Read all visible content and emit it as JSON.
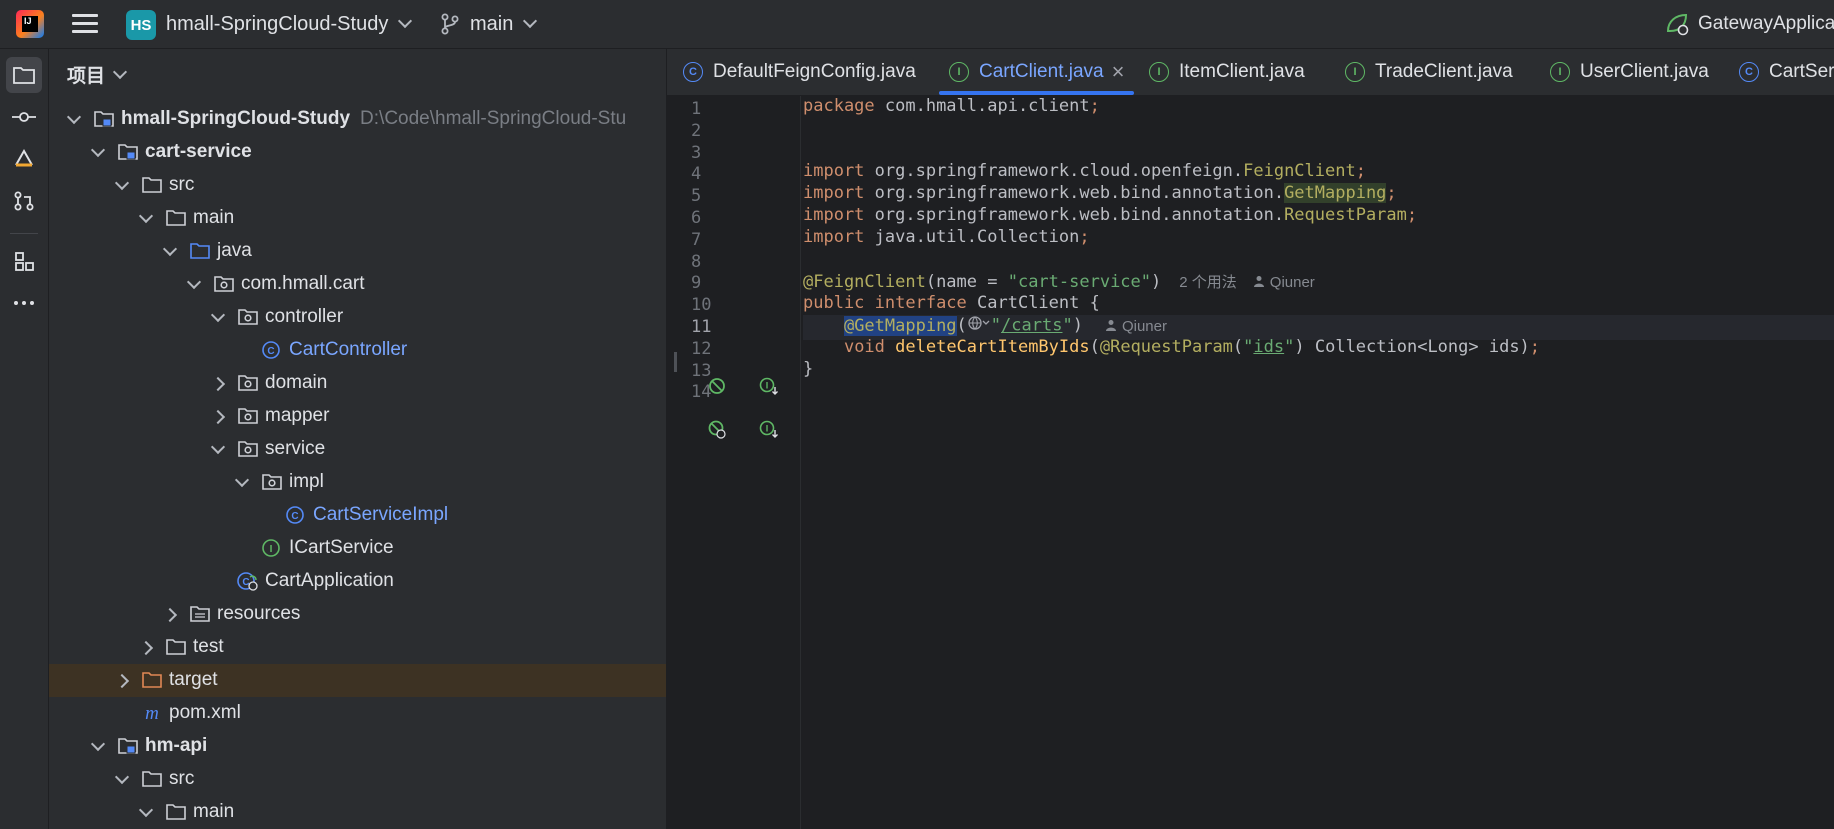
{
  "titlebar": {
    "project_badge": "HS",
    "project_name": "hmall-SpringCloud-Study",
    "branch": "main",
    "run_config": "GatewayApplica"
  },
  "project_panel": {
    "title": "项目",
    "tree": [
      {
        "label": "hmall-SpringCloud-Study",
        "hint": "D:\\Code\\hmall-SpringCloud-Stu",
        "depth": 0,
        "arrow": "down",
        "icon": "module-folder-icon",
        "bold": true
      },
      {
        "label": "cart-service",
        "depth": 1,
        "arrow": "down",
        "icon": "module-folder-icon",
        "bold": true
      },
      {
        "label": "src",
        "depth": 2,
        "arrow": "down",
        "icon": "folder-icon"
      },
      {
        "label": "main",
        "depth": 3,
        "arrow": "down",
        "icon": "folder-icon"
      },
      {
        "label": "java",
        "depth": 4,
        "arrow": "down",
        "icon": "source-folder-icon"
      },
      {
        "label": "com.hmall.cart",
        "depth": 5,
        "arrow": "down",
        "icon": "package-icon"
      },
      {
        "label": "controller",
        "depth": 6,
        "arrow": "down",
        "icon": "package-icon"
      },
      {
        "label": "CartController",
        "depth": 7,
        "arrow": "none",
        "icon": "class-icon",
        "color": "#7aa6ff"
      },
      {
        "label": "domain",
        "depth": 6,
        "arrow": "right",
        "icon": "package-icon"
      },
      {
        "label": "mapper",
        "depth": 6,
        "arrow": "right",
        "icon": "package-icon"
      },
      {
        "label": "service",
        "depth": 6,
        "arrow": "down",
        "icon": "package-icon"
      },
      {
        "label": "impl",
        "depth": 7,
        "arrow": "down",
        "icon": "package-icon"
      },
      {
        "label": "CartServiceImpl",
        "depth": 8,
        "arrow": "none",
        "icon": "class-icon",
        "color": "#7aa6ff"
      },
      {
        "label": "ICartService",
        "depth": 7,
        "arrow": "none",
        "icon": "interface-icon"
      },
      {
        "label": "CartApplication",
        "depth": 6,
        "arrow": "none",
        "icon": "spring-class-icon"
      },
      {
        "label": "resources",
        "depth": 4,
        "arrow": "right",
        "icon": "resources-folder-icon"
      },
      {
        "label": "test",
        "depth": 3,
        "arrow": "right",
        "icon": "folder-icon"
      },
      {
        "label": "target",
        "depth": 2,
        "arrow": "right",
        "icon": "excluded-folder-icon",
        "selected": true
      },
      {
        "label": "pom.xml",
        "depth": 2,
        "arrow": "none",
        "icon": "maven-icon"
      },
      {
        "label": "hm-api",
        "depth": 1,
        "arrow": "down",
        "icon": "module-folder-icon",
        "bold": true
      },
      {
        "label": "src",
        "depth": 2,
        "arrow": "down",
        "icon": "folder-icon"
      },
      {
        "label": "main",
        "depth": 3,
        "arrow": "down",
        "icon": "folder-icon"
      }
    ]
  },
  "tabs": [
    {
      "label": "DefaultFeignConfig.java",
      "icon": "class-icon",
      "glyph": "C",
      "active": false
    },
    {
      "label": "CartClient.java",
      "icon": "interface-icon",
      "glyph": "I",
      "active": true,
      "close": "×"
    },
    {
      "label": "ItemClient.java",
      "icon": "interface-icon",
      "glyph": "I",
      "active": false
    },
    {
      "label": "TradeClient.java",
      "icon": "interface-icon",
      "glyph": "I",
      "active": false
    },
    {
      "label": "UserClient.java",
      "icon": "interface-icon",
      "glyph": "I",
      "active": false
    },
    {
      "label": "CartSer",
      "icon": "class-icon",
      "glyph": "C",
      "active": false
    }
  ],
  "editor": {
    "line_numbers": [
      "1",
      "2",
      "3",
      "4",
      "5",
      "6",
      "7",
      "8",
      "9",
      "10",
      "11",
      "12",
      "13",
      "14"
    ],
    "current_line": "11",
    "code": {
      "l1_kw": "package",
      "l1_rest": " com.hmall.api.client",
      "l1_semi": ";",
      "imp": "import",
      "l4_pkg": " org.springframework.cloud.openfeign.",
      "l4_cls": "FeignClient",
      "l5_pkg": " org.springframework.web.bind.annotation.",
      "l5_cls": "GetMapping",
      "l6_pkg": " org.springframework.web.bind.annotation.",
      "l6_cls": "RequestParam",
      "l7_pkg": " java.util.Collection",
      "semi": ";",
      "l9_ann": "@FeignClient",
      "l9_open": "(name = ",
      "l9_str": "\"cart-service\"",
      "l9_close": ")",
      "l9_usages": "2 个用法",
      "author": "Qiuner",
      "l10_pub": "public",
      "l10_iface": " interface",
      "l10_name": " CartClient {",
      "l11_indent": "    ",
      "l11_ann": "@GetMapping",
      "l11_open": "(",
      "l11_str_q1": "\"",
      "l11_str_path": "/carts",
      "l11_str_q2": "\"",
      "l11_close": ")",
      "l12_indent": "    ",
      "l12_void": "void",
      "l12_method": " deleteCartItemByIds",
      "l12_paren": "(",
      "l12_ann": "@RequestParam",
      "l12_p1": "(",
      "l12_str_q1": "\"",
      "l12_str_val": "ids",
      "l12_str_q2": "\"",
      "l12_rest": ") Collection<Long> ids)",
      "l13_brace": "}"
    }
  },
  "colors": {
    "keyword": "#cf8e6d",
    "annotation": "#b3ae60",
    "string": "#6aab73",
    "accent": "#3574f0",
    "method": "#ffc66d"
  }
}
